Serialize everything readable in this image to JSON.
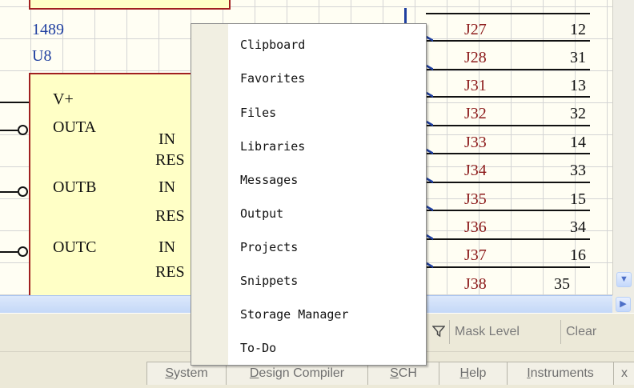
{
  "schematic": {
    "value_label": "1489",
    "refdes": "U8",
    "pins_left": [
      "V+",
      "OUTA",
      "OUTB",
      "OUTC"
    ],
    "pins_right": [
      "IN",
      "RES",
      "IN",
      "RES",
      "IN",
      "RES"
    ],
    "nets": [
      {
        "label": "J27",
        "number": "12"
      },
      {
        "label": "J28",
        "number": "31"
      },
      {
        "label": "J31",
        "number": "13"
      },
      {
        "label": "J32",
        "number": "32"
      },
      {
        "label": "J33",
        "number": "14"
      },
      {
        "label": "J34",
        "number": "33"
      },
      {
        "label": "J35",
        "number": "15"
      },
      {
        "label": "J36",
        "number": "34"
      },
      {
        "label": "J37",
        "number": "16"
      },
      {
        "label": "J38",
        "number": "35"
      }
    ]
  },
  "context_menu": {
    "items": [
      "Clipboard",
      "Favorites",
      "Files",
      "Libraries",
      "Messages",
      "Output",
      "Projects",
      "Snippets",
      "Storage Manager",
      "To-Do"
    ]
  },
  "panel_bar": {
    "filter_icon": "funnel-icon",
    "mask_level": "Mask Level",
    "clear": "Clear"
  },
  "status_bar": {
    "buttons": [
      {
        "first": "S",
        "rest": "ystem"
      },
      {
        "first": "D",
        "rest": "esign Compiler"
      },
      {
        "first": "S",
        "rest": "CH"
      },
      {
        "first": "H",
        "rest": "elp"
      },
      {
        "first": "I",
        "rest": "nstruments"
      }
    ],
    "overflow": "x"
  },
  "colors": {
    "canvas": "#fffef3",
    "component_fill": "#ffffc6",
    "component_border": "#a12020",
    "net_label": "#8c1a1a",
    "ref_text": "#1f3fa0",
    "scrollbar_blue": "#c3d7f7"
  }
}
